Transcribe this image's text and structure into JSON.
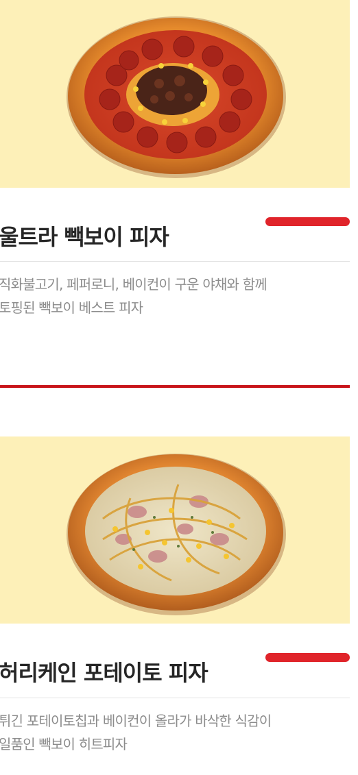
{
  "products": [
    {
      "title": "울트라 빽보이 피자",
      "description_lines": [
        "직화불고기, 페퍼로니, 베이컨이 구운 야채와 함께",
        "토핑된 빽보이 베스트 피자"
      ],
      "image": "pizza-ultra-photo"
    },
    {
      "title": "허리케인 포테이토 피자",
      "description_lines": [
        "튀긴 포테이토칩과 베이컨이 올라가 바삭한 식감이",
        "일품인 빽보이 히트피자"
      ],
      "image": "pizza-hurricane-photo"
    }
  ],
  "colors": {
    "hero_background": "#fdf0b8",
    "accent": "#e0242a",
    "separator": "#c8141a",
    "title": "#262626",
    "description": "#8c8c8c"
  }
}
